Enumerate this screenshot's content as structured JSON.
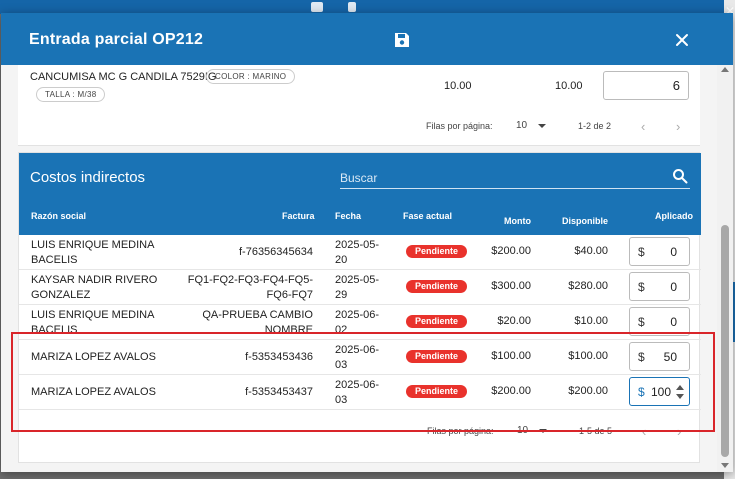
{
  "modal": {
    "title": "Entrada parcial OP212"
  },
  "product": {
    "name": "CANCUMISA MC G CANDILA 7529IG",
    "chips": [
      "COLOR : MARINO",
      "TALLA : M/38"
    ],
    "value_a": "10.00",
    "value_b": "10.00",
    "quantity": "6",
    "pager": {
      "label": "Filas por página:",
      "per_page": "10",
      "range": "1-2 de 2"
    }
  },
  "costos": {
    "title": "Costos indirectos",
    "search_placeholder": "Buscar",
    "headers": {
      "razon_social": "Razón social",
      "factura": "Factura",
      "fecha": "Fecha",
      "fase": "Fase actual",
      "monto": "Monto",
      "disponible": "Disponible",
      "aplicado": "Aplicado"
    },
    "rows": [
      {
        "rs1": "LUIS ENRIQUE MEDINA",
        "rs2": "BACELIS",
        "fac1": "f-76356345634",
        "fac2": "",
        "fec1": "2025-05-",
        "fec2": "20",
        "fase": "Pendiente",
        "monto": "$200.00",
        "disponible": "$40.00",
        "currency": "$",
        "aplicado": "0"
      },
      {
        "rs1": "KAYSAR NADIR RIVERO",
        "rs2": "GONZALEZ",
        "fac1": "FQ1-FQ2-FQ3-FQ4-FQ5-",
        "fac2": "FQ6-FQ7",
        "fec1": "2025-05-",
        "fec2": "29",
        "fase": "Pendiente",
        "monto": "$300.00",
        "disponible": "$280.00",
        "currency": "$",
        "aplicado": "0"
      },
      {
        "rs1": "LUIS ENRIQUE MEDINA",
        "rs2": "BACELIS",
        "fac1": "QA-PRUEBA CAMBIO",
        "fac2": "NOMBRE",
        "fec1": "2025-06-",
        "fec2": "02",
        "fase": "Pendiente",
        "monto": "$20.00",
        "disponible": "$10.00",
        "currency": "$",
        "aplicado": "0"
      },
      {
        "rs1": "MARIZA LOPEZ AVALOS",
        "rs2": "",
        "fac1": "f-5353453436",
        "fac2": "",
        "fec1": "2025-06-",
        "fec2": "03",
        "fase": "Pendiente",
        "monto": "$100.00",
        "disponible": "$100.00",
        "currency": "$",
        "aplicado": "50"
      },
      {
        "rs1": "MARIZA LOPEZ AVALOS",
        "rs2": "",
        "fac1": "f-5353453437",
        "fac2": "",
        "fec1": "2025-06-",
        "fec2": "03",
        "fase": "Pendiente",
        "monto": "$200.00",
        "disponible": "$200.00",
        "currency": "$",
        "aplicado": "100"
      }
    ],
    "pager": {
      "label": "Filas por página:",
      "per_page": "10",
      "range": "1-5 de 5"
    }
  },
  "colors": {
    "primary": "#1a73b5",
    "badge": "#e9322c",
    "highlight": "#d9252a"
  }
}
